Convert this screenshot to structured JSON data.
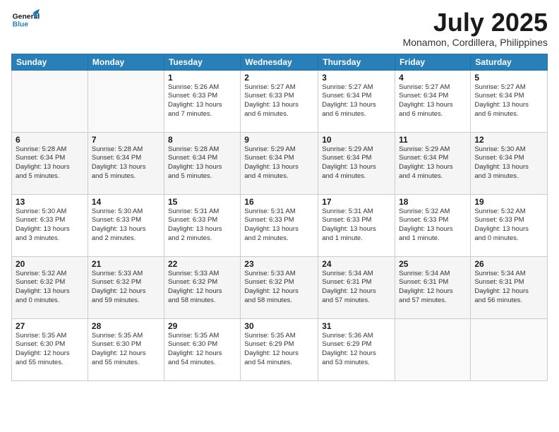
{
  "header": {
    "logo_general": "General",
    "logo_blue": "Blue",
    "month_title": "July 2025",
    "location": "Monamon, Cordillera, Philippines"
  },
  "weekdays": [
    "Sunday",
    "Monday",
    "Tuesday",
    "Wednesday",
    "Thursday",
    "Friday",
    "Saturday"
  ],
  "weeks": [
    [
      {
        "day": "",
        "info": ""
      },
      {
        "day": "",
        "info": ""
      },
      {
        "day": "1",
        "info": "Sunrise: 5:26 AM\nSunset: 6:33 PM\nDaylight: 13 hours\nand 7 minutes."
      },
      {
        "day": "2",
        "info": "Sunrise: 5:27 AM\nSunset: 6:33 PM\nDaylight: 13 hours\nand 6 minutes."
      },
      {
        "day": "3",
        "info": "Sunrise: 5:27 AM\nSunset: 6:34 PM\nDaylight: 13 hours\nand 6 minutes."
      },
      {
        "day": "4",
        "info": "Sunrise: 5:27 AM\nSunset: 6:34 PM\nDaylight: 13 hours\nand 6 minutes."
      },
      {
        "day": "5",
        "info": "Sunrise: 5:27 AM\nSunset: 6:34 PM\nDaylight: 13 hours\nand 6 minutes."
      }
    ],
    [
      {
        "day": "6",
        "info": "Sunrise: 5:28 AM\nSunset: 6:34 PM\nDaylight: 13 hours\nand 5 minutes."
      },
      {
        "day": "7",
        "info": "Sunrise: 5:28 AM\nSunset: 6:34 PM\nDaylight: 13 hours\nand 5 minutes."
      },
      {
        "day": "8",
        "info": "Sunrise: 5:28 AM\nSunset: 6:34 PM\nDaylight: 13 hours\nand 5 minutes."
      },
      {
        "day": "9",
        "info": "Sunrise: 5:29 AM\nSunset: 6:34 PM\nDaylight: 13 hours\nand 4 minutes."
      },
      {
        "day": "10",
        "info": "Sunrise: 5:29 AM\nSunset: 6:34 PM\nDaylight: 13 hours\nand 4 minutes."
      },
      {
        "day": "11",
        "info": "Sunrise: 5:29 AM\nSunset: 6:34 PM\nDaylight: 13 hours\nand 4 minutes."
      },
      {
        "day": "12",
        "info": "Sunrise: 5:30 AM\nSunset: 6:34 PM\nDaylight: 13 hours\nand 3 minutes."
      }
    ],
    [
      {
        "day": "13",
        "info": "Sunrise: 5:30 AM\nSunset: 6:33 PM\nDaylight: 13 hours\nand 3 minutes."
      },
      {
        "day": "14",
        "info": "Sunrise: 5:30 AM\nSunset: 6:33 PM\nDaylight: 13 hours\nand 2 minutes."
      },
      {
        "day": "15",
        "info": "Sunrise: 5:31 AM\nSunset: 6:33 PM\nDaylight: 13 hours\nand 2 minutes."
      },
      {
        "day": "16",
        "info": "Sunrise: 5:31 AM\nSunset: 6:33 PM\nDaylight: 13 hours\nand 2 minutes."
      },
      {
        "day": "17",
        "info": "Sunrise: 5:31 AM\nSunset: 6:33 PM\nDaylight: 13 hours\nand 1 minute."
      },
      {
        "day": "18",
        "info": "Sunrise: 5:32 AM\nSunset: 6:33 PM\nDaylight: 13 hours\nand 1 minute."
      },
      {
        "day": "19",
        "info": "Sunrise: 5:32 AM\nSunset: 6:33 PM\nDaylight: 13 hours\nand 0 minutes."
      }
    ],
    [
      {
        "day": "20",
        "info": "Sunrise: 5:32 AM\nSunset: 6:32 PM\nDaylight: 13 hours\nand 0 minutes."
      },
      {
        "day": "21",
        "info": "Sunrise: 5:33 AM\nSunset: 6:32 PM\nDaylight: 12 hours\nand 59 minutes."
      },
      {
        "day": "22",
        "info": "Sunrise: 5:33 AM\nSunset: 6:32 PM\nDaylight: 12 hours\nand 58 minutes."
      },
      {
        "day": "23",
        "info": "Sunrise: 5:33 AM\nSunset: 6:32 PM\nDaylight: 12 hours\nand 58 minutes."
      },
      {
        "day": "24",
        "info": "Sunrise: 5:34 AM\nSunset: 6:31 PM\nDaylight: 12 hours\nand 57 minutes."
      },
      {
        "day": "25",
        "info": "Sunrise: 5:34 AM\nSunset: 6:31 PM\nDaylight: 12 hours\nand 57 minutes."
      },
      {
        "day": "26",
        "info": "Sunrise: 5:34 AM\nSunset: 6:31 PM\nDaylight: 12 hours\nand 56 minutes."
      }
    ],
    [
      {
        "day": "27",
        "info": "Sunrise: 5:35 AM\nSunset: 6:30 PM\nDaylight: 12 hours\nand 55 minutes."
      },
      {
        "day": "28",
        "info": "Sunrise: 5:35 AM\nSunset: 6:30 PM\nDaylight: 12 hours\nand 55 minutes."
      },
      {
        "day": "29",
        "info": "Sunrise: 5:35 AM\nSunset: 6:30 PM\nDaylight: 12 hours\nand 54 minutes."
      },
      {
        "day": "30",
        "info": "Sunrise: 5:35 AM\nSunset: 6:29 PM\nDaylight: 12 hours\nand 54 minutes."
      },
      {
        "day": "31",
        "info": "Sunrise: 5:36 AM\nSunset: 6:29 PM\nDaylight: 12 hours\nand 53 minutes."
      },
      {
        "day": "",
        "info": ""
      },
      {
        "day": "",
        "info": ""
      }
    ]
  ]
}
